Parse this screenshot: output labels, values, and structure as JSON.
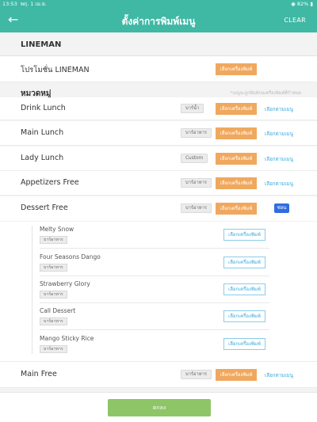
{
  "status_bar": {
    "time": "13:53",
    "date": "พฤ. 1 เม.ย.",
    "battery": "82%",
    "icons": [
      "wifi-icon",
      "battery-icon"
    ]
  },
  "header": {
    "back_icon": "arrow-left-icon",
    "title": "ตั้งค่าการพิมพ์เมนู",
    "clear_label": "CLEAR"
  },
  "section_lineman": {
    "title": "LINEMAN"
  },
  "promo_row": {
    "name": "โปรโมชั่น LINEMAN",
    "select_printer": "เลือกเครื่องพิมพ์"
  },
  "section_category": {
    "title": "หมวดหมู่",
    "note": "*เมนูจะถูกพิมพ์บนเครื่องพิมพ์ที่กำหนด"
  },
  "categories": [
    {
      "name": "Drink Lunch",
      "tag": "บาร์น้ำ",
      "select_printer": "เลือกเครื่องพิมพ์",
      "by_menu": "เลือกตามเมนู"
    },
    {
      "name": "Main Lunch",
      "tag": "บาร์อาหาร",
      "select_printer": "เลือกเครื่องพิมพ์",
      "by_menu": "เลือกตามเมนู"
    },
    {
      "name": "Lady Lunch",
      "tag": "Custom",
      "select_printer": "เลือกเครื่องพิมพ์",
      "by_menu": "เลือกตามเมนู"
    },
    {
      "name": "Appetizers  Free",
      "tag": "บาร์อาหาร",
      "select_printer": "เลือกเครื่องพิมพ์",
      "by_menu": "เลือกตามเมนู"
    },
    {
      "name": "Dessert Free",
      "tag": "บาร์อาหาร",
      "select_printer": "เลือกเครื่องพิมพ์",
      "hide_label": "ซ่อน"
    }
  ],
  "dessert_items": [
    {
      "name": "Melty Snow",
      "tag": "บาร์อาหาร",
      "select_printer": "เลือกเครื่องพิมพ์"
    },
    {
      "name": "Four Seasons Dango",
      "tag": "บาร์อาหาร",
      "select_printer": "เลือกเครื่องพิมพ์"
    },
    {
      "name": "Strawberry Glory",
      "tag": "บาร์อาหาร",
      "select_printer": "เลือกเครื่องพิมพ์"
    },
    {
      "name": "Call Dessert",
      "tag": "บาร์อาหาร",
      "select_printer": "เลือกเครื่องพิมพ์"
    },
    {
      "name": "Mango Sticky Rice",
      "tag": "บาร์อาหาร",
      "select_printer": "เลือกเครื่องพิมพ์"
    }
  ],
  "main_free": {
    "name": "Main Free",
    "tag": "บาร์อาหาร",
    "select_printer": "เลือกเครื่องพิมพ์",
    "by_menu": "เลือกตามเมนู"
  },
  "footer": {
    "ok_label": "ตกลง"
  },
  "colors": {
    "header": "#3fb8a4",
    "orange": "#f0a85e",
    "link": "#3aa9de",
    "green": "#8dc567",
    "hide_badge": "#2f6de0"
  }
}
